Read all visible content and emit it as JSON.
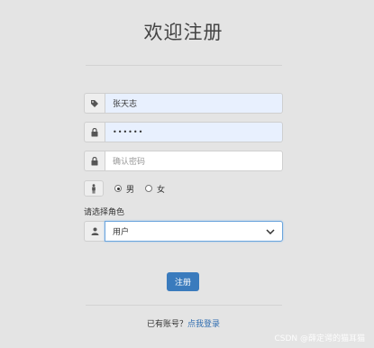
{
  "page": {
    "title": "欢迎注册"
  },
  "form": {
    "username": {
      "value": "张天志",
      "icon": "tag-icon"
    },
    "password": {
      "value": "••••••",
      "icon": "lock-icon"
    },
    "confirm_password": {
      "placeholder": "确认密码",
      "icon": "lock-icon"
    },
    "gender": {
      "icon": "person-icon",
      "options": [
        {
          "label": "男",
          "selected": true
        },
        {
          "label": "女",
          "selected": false
        }
      ]
    },
    "role": {
      "label": "请选择角色",
      "icon": "user-icon",
      "selected": "用户"
    },
    "submit_label": "注册"
  },
  "footer": {
    "prompt": "已有账号？",
    "login_link": "点我登录"
  },
  "watermark": "CSDN @薛定谔的猫耳猫",
  "colors": {
    "background": "#e4e4e4",
    "button": "#3a7bbd",
    "link": "#2f6db0",
    "autofill": "#e8f0fe"
  }
}
